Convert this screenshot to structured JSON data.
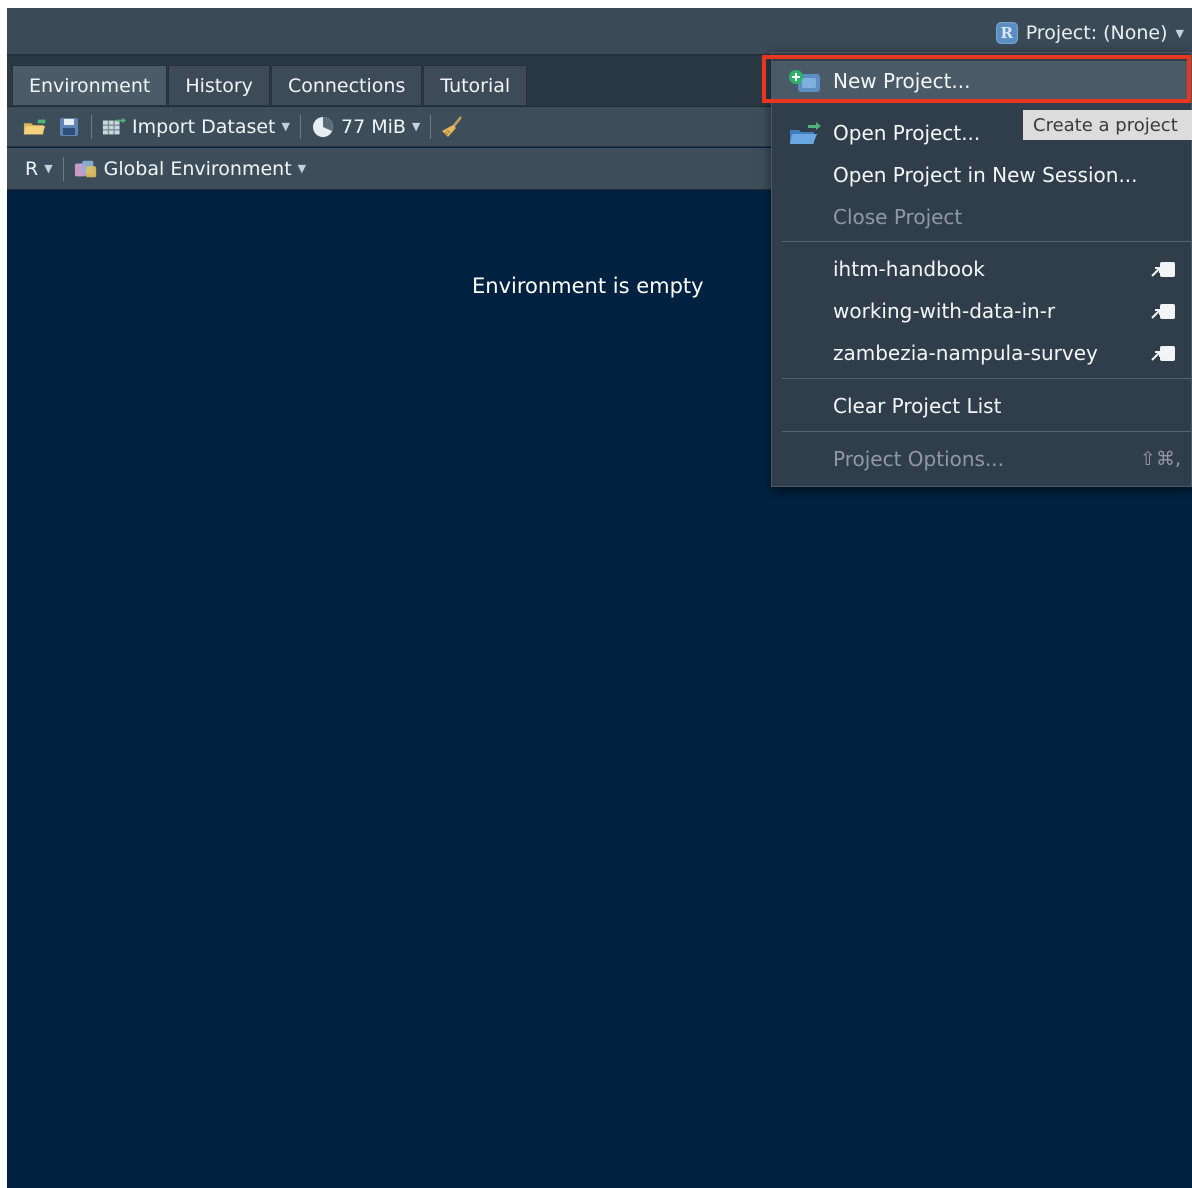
{
  "project_bar": {
    "label": "Project: (None)",
    "logo_letter": "R"
  },
  "tabs": [
    {
      "label": "Environment",
      "active": true
    },
    {
      "label": "History"
    },
    {
      "label": "Connections"
    },
    {
      "label": "Tutorial"
    }
  ],
  "toolbar": {
    "import_dataset": "Import Dataset",
    "memory": "77 MiB"
  },
  "env_bar": {
    "language": "R",
    "environment": "Global Environment"
  },
  "main": {
    "empty_message": "Environment is empty"
  },
  "project_menu": {
    "new_project": "New Project...",
    "open_project": "Open Project...",
    "open_in_new_session": "Open Project in New Session...",
    "close_project": "Close Project",
    "recent_projects": [
      "ihtm-handbook",
      "working-with-data-in-r",
      "zambezia-nampula-survey"
    ],
    "clear_list": "Clear Project List",
    "project_options": "Project Options...",
    "project_options_shortcut": "⇧⌘,"
  },
  "tooltip": "Create a project",
  "colors": {
    "editor_background": "#002240",
    "highlight_border": "#e8361f"
  }
}
